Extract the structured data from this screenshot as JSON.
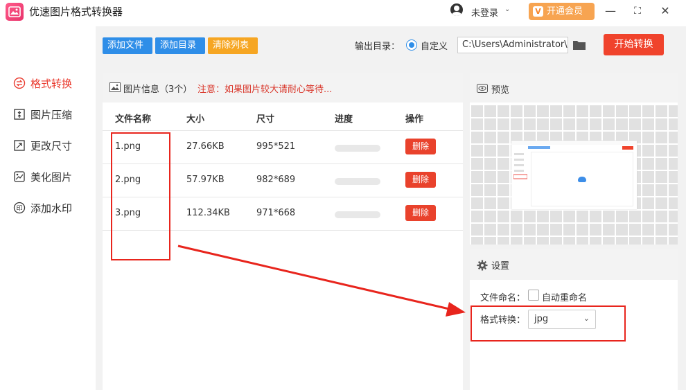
{
  "app": {
    "title": "优速图片格式转换器",
    "user_label": "未登录",
    "user_caret": "⌄",
    "vip_label": "开通会员",
    "vip_icon": "V"
  },
  "window_controls": {
    "minimize": "—",
    "maximize": "⛶",
    "close": "✕"
  },
  "sidebar": {
    "items": [
      {
        "label": "格式转换",
        "icon": "format-convert-icon",
        "active": true
      },
      {
        "label": "图片压缩",
        "icon": "compress-icon",
        "active": false
      },
      {
        "label": "更改尺寸",
        "icon": "resize-icon",
        "active": false
      },
      {
        "label": "美化图片",
        "icon": "beautify-icon",
        "active": false
      },
      {
        "label": "添加水印",
        "icon": "watermark-icon",
        "active": false
      }
    ]
  },
  "toolbar": {
    "add_file": "添加文件",
    "add_dir": "添加目录",
    "clear_list": "清除列表",
    "output_label": "输出目录：",
    "radio_label": "自定义",
    "output_path": "C:\\Users\\Administrator\\",
    "start_label": "开始转换"
  },
  "file_panel": {
    "title": "图片信息（3个）",
    "notice": "注意：如果图片较大请耐心等待...",
    "columns": [
      "文件名称",
      "大小",
      "尺寸",
      "进度",
      "操作"
    ],
    "rows": [
      {
        "name": "1.png",
        "size": "27.66KB",
        "dims": "995*521",
        "progress": 0,
        "action": "删除"
      },
      {
        "name": "2.png",
        "size": "57.97KB",
        "dims": "982*689",
        "progress": 0,
        "action": "删除"
      },
      {
        "name": "3.png",
        "size": "112.34KB",
        "dims": "971*668",
        "progress": 0,
        "action": "删除"
      }
    ]
  },
  "preview": {
    "title": "预览"
  },
  "settings": {
    "title": "设置",
    "naming_label": "文件命名：",
    "auto_rename_label": "自动重命名",
    "auto_rename_checked": false,
    "format_label": "格式转换：",
    "format_value": "jpg",
    "format_caret": "⌄"
  },
  "colors": {
    "accent_red": "#f0432c",
    "accent_blue": "#2f8ee8",
    "accent_orange": "#f6a623",
    "annotation_red": "#e8251d"
  }
}
